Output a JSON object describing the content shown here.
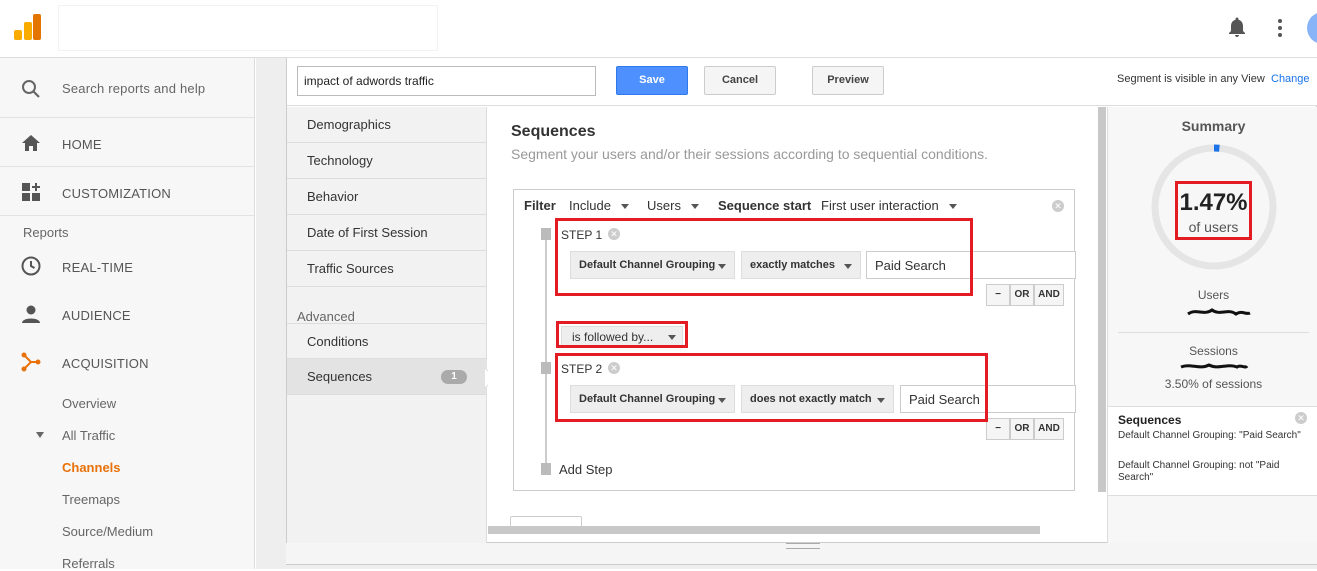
{
  "topbar": {
    "logo_icon": "analytics-logo-icon",
    "notifications_icon": "bell-icon",
    "menu_icon": "more-vert-icon"
  },
  "sidebar": {
    "search_placeholder": "Search reports and help",
    "home": "HOME",
    "customization": "CUSTOMIZATION",
    "reports_heading": "Reports",
    "realtime": "REAL-TIME",
    "audience": "AUDIENCE",
    "acquisition": "ACQUISITION",
    "overview": "Overview",
    "all_traffic": "All Traffic",
    "channels": "Channels",
    "treemaps": "Treemaps",
    "source_medium": "Source/Medium",
    "referrals": "Referrals",
    "accent_color": "#e8710a"
  },
  "segment": {
    "name_value": "impact of adwords traffic",
    "save_label": "Save",
    "cancel_label": "Cancel",
    "preview_label": "Preview",
    "visibility_text": "Segment is visible in any View",
    "change_label": "Change"
  },
  "categories": {
    "items": [
      "Demographics",
      "Technology",
      "Behavior",
      "Date of First Session",
      "Traffic Sources"
    ],
    "advanced_heading": "Advanced",
    "conditions": "Conditions",
    "sequences": "Sequences",
    "sequences_count": "1"
  },
  "sequences": {
    "title": "Sequences",
    "subtitle": "Segment your users and/or their sessions according to sequential conditions.",
    "filter_label": "Filter",
    "include_value": "Include",
    "users_value": "Users",
    "sequence_start_label": "Sequence start",
    "sequence_start_value": "First user interaction",
    "step1": {
      "label": "STEP 1",
      "dimension": "Default Channel Grouping",
      "operator": "exactly matches",
      "value": "Paid Search"
    },
    "followed_by": "is followed by...",
    "step2": {
      "label": "STEP 2",
      "dimension": "Default Channel Grouping",
      "operator": "does not exactly match",
      "value": "Paid Search"
    },
    "minus_label": "−",
    "or_label": "OR",
    "and_label": "AND",
    "add_step": "Add Step",
    "highlight_color": "#e31b23"
  },
  "summary": {
    "title": "Summary",
    "percent": "1.47%",
    "percent_caption": "of users",
    "users_label": "Users",
    "sessions_label": "Sessions",
    "sessions_pct": "3.50% of sessions",
    "seq_title": "Sequences",
    "cond1": "Default Channel Grouping: \"Paid Search\"",
    "cond2": "Default Channel Grouping: not \"Paid Search\"",
    "ring_color": "#1a73e8"
  }
}
